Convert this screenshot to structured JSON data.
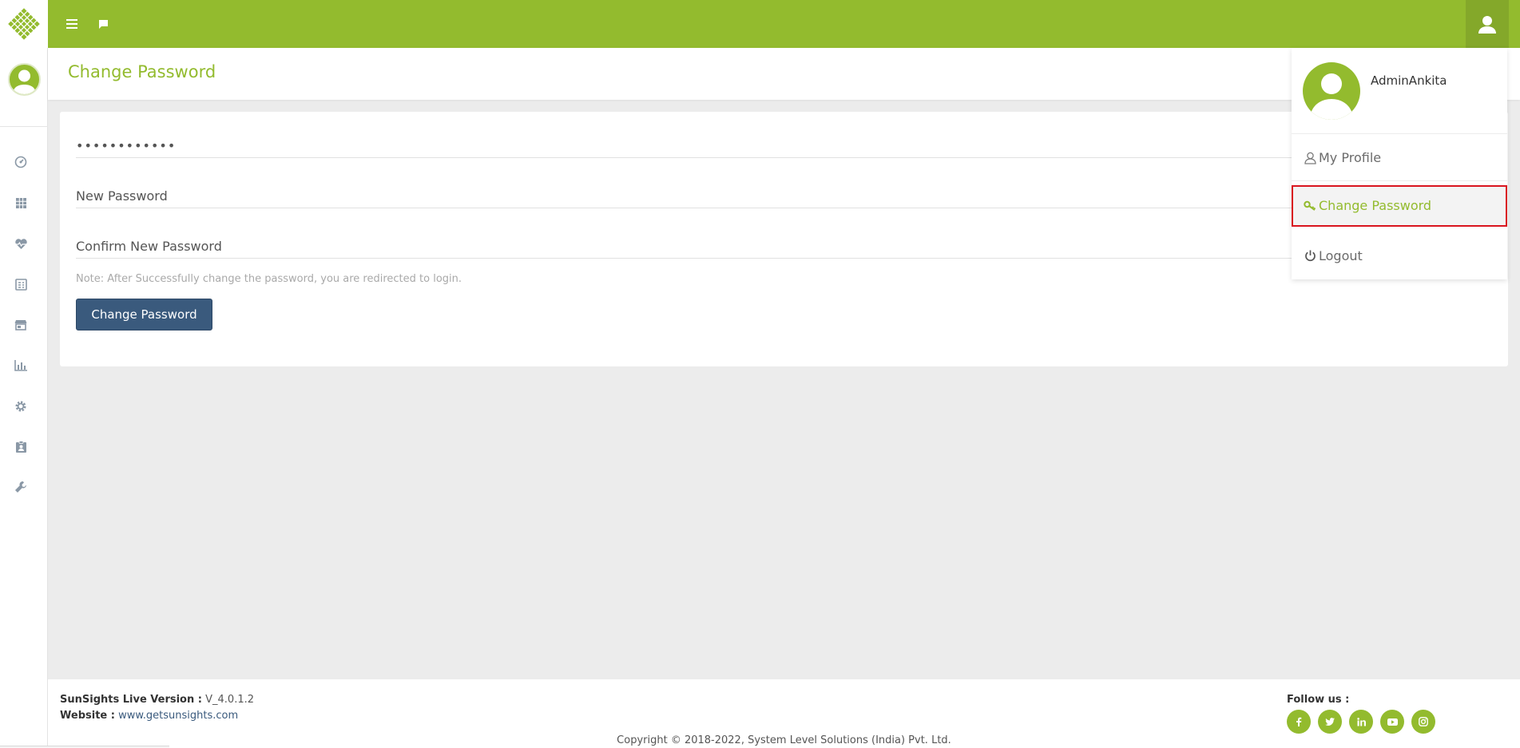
{
  "topbar": {
    "menu_icon": "hamburger-menu-icon",
    "chat_icon": "chat-icon",
    "user_icon": "user-icon"
  },
  "sidebar": {
    "items": [
      {
        "name": "dashboard",
        "icon": "gauge-icon"
      },
      {
        "name": "plants",
        "icon": "grid-icon"
      },
      {
        "name": "health",
        "icon": "heart-pulse-icon"
      },
      {
        "name": "reports",
        "icon": "report-icon"
      },
      {
        "name": "store",
        "icon": "store-icon"
      },
      {
        "name": "analytics",
        "icon": "bar-chart-icon"
      },
      {
        "name": "settings",
        "icon": "gear-icon"
      },
      {
        "name": "clipboard",
        "icon": "clipboard-user-icon"
      },
      {
        "name": "tools",
        "icon": "wrench-icon"
      }
    ]
  },
  "page": {
    "title": "Change Password"
  },
  "form": {
    "current_password_value": "••••••••••••",
    "new_password_placeholder": "New Password",
    "confirm_password_placeholder": "Confirm New Password",
    "note": "Note: After Successfully change the password, you are redirected to login.",
    "submit_label": "Change Password"
  },
  "user_menu": {
    "username": "AdminAnkita",
    "items": [
      {
        "label": "My Profile",
        "icon": "user-outline-icon"
      },
      {
        "label": "Change Password",
        "icon": "key-icon"
      },
      {
        "label": "Logout",
        "icon": "power-icon"
      }
    ]
  },
  "footer": {
    "version_label": "SunSights Live Version :",
    "version_value": "V_4.0.1.2",
    "website_label": "Website :",
    "website_value": "www.getsunsights.com",
    "follow_label": "Follow us :",
    "socials": [
      "f",
      "t",
      "in",
      "yt",
      "ig"
    ],
    "copyright": "Copyright © 2018-2022, System Level Solutions (India) Pvt. Ltd."
  },
  "colors": {
    "brand_green": "#93bb2e",
    "button_blue": "#3a5a7d",
    "highlight_red": "#d9141e"
  }
}
